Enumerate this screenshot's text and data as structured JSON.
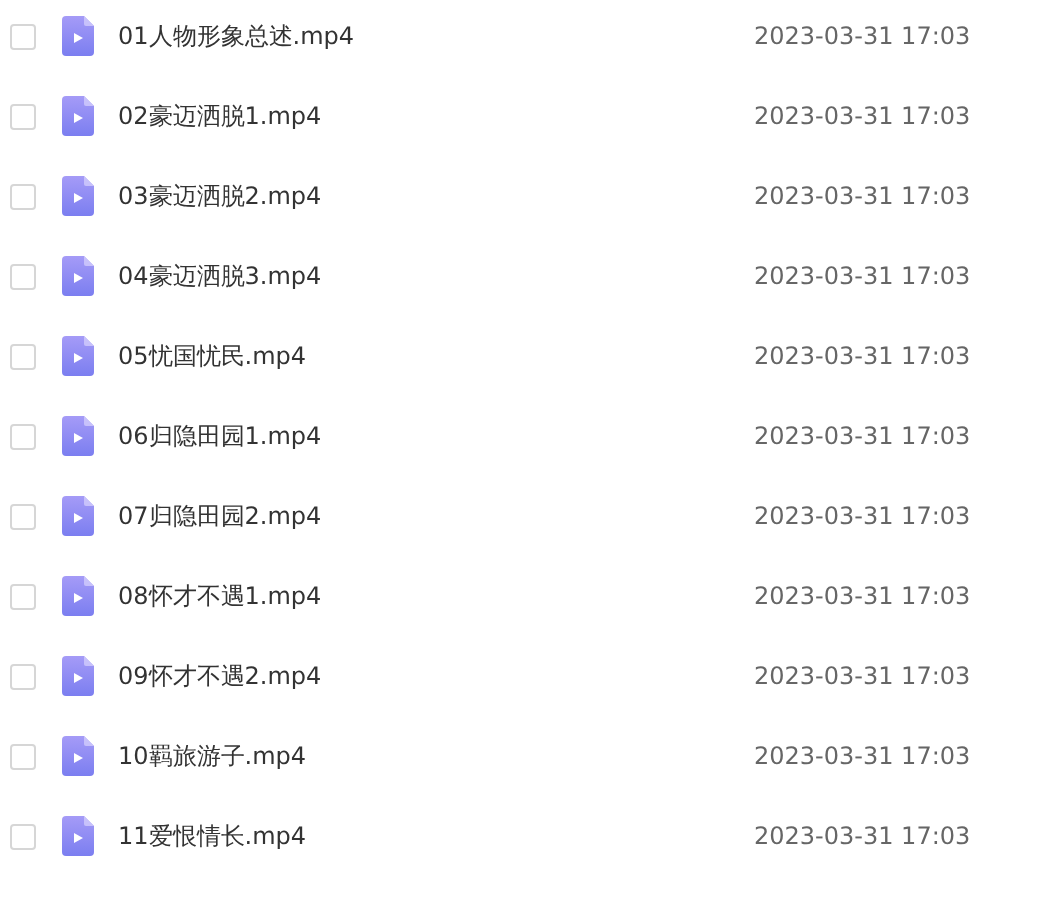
{
  "files": [
    {
      "name": "01人物形象总述.mp4",
      "date": "2023-03-31 17:03",
      "checked": false
    },
    {
      "name": "02豪迈洒脱1.mp4",
      "date": "2023-03-31 17:03",
      "checked": false
    },
    {
      "name": "03豪迈洒脱2.mp4",
      "date": "2023-03-31 17:03",
      "checked": false
    },
    {
      "name": "04豪迈洒脱3.mp4",
      "date": "2023-03-31 17:03",
      "checked": false
    },
    {
      "name": "05忧国忧民.mp4",
      "date": "2023-03-31 17:03",
      "checked": false
    },
    {
      "name": "06归隐田园1.mp4",
      "date": "2023-03-31 17:03",
      "checked": false
    },
    {
      "name": "07归隐田园2.mp4",
      "date": "2023-03-31 17:03",
      "checked": false
    },
    {
      "name": "08怀才不遇1.mp4",
      "date": "2023-03-31 17:03",
      "checked": false
    },
    {
      "name": "09怀才不遇2.mp4",
      "date": "2023-03-31 17:03",
      "checked": false
    },
    {
      "name": "10羁旅游子.mp4",
      "date": "2023-03-31 17:03",
      "checked": false
    },
    {
      "name": "11爱恨情长.mp4",
      "date": "2023-03-31 17:03",
      "checked": false
    }
  ]
}
